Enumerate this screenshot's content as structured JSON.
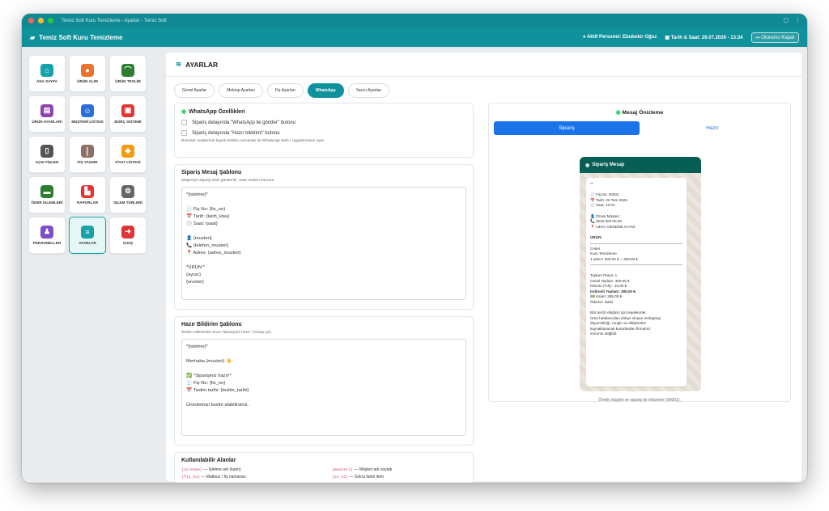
{
  "window": {
    "title": "Temiz Soft Kuru Temizleme - Ayarlar - Temiz Soft"
  },
  "colors": {
    "teal": "#10929c",
    "teal_dark": "#0f8a95",
    "whatsapp": "#075e54",
    "blue": "#1a73e8"
  },
  "appbar": {
    "app_name": "Temiz Soft Kuru Temizleme",
    "active_staff": "Aktif Personel: Ebubekir Oğuz",
    "datetime": "Tarih & Saat: 26.07.2026 - 13:34",
    "logout": "Oturumu Kapat"
  },
  "sidebar": {
    "tiles": [
      {
        "label": "ANA SAYFA",
        "icon": "home-icon",
        "color": "#16a2a8",
        "glyph": "⌂"
      },
      {
        "label": "ÜRÜN ALIM",
        "icon": "target-icon",
        "color": "#e8742d",
        "glyph": "●"
      },
      {
        "label": "ÜRÜN TESLİM",
        "icon": "hanger-icon",
        "color": "#2e7d32",
        "glyph": "⌒"
      },
      {
        "label": "ÜRÜN AYARLARI",
        "icon": "box-icon",
        "color": "#8e44ad",
        "glyph": "▤"
      },
      {
        "label": "MÜŞTERİ LİSTESİ",
        "icon": "users-icon",
        "color": "#2c6fd6",
        "glyph": "☺"
      },
      {
        "label": "BORÇ SİSTEMİ",
        "icon": "wallet-icon",
        "color": "#e03535",
        "glyph": "▣"
      },
      {
        "label": "AÇIK FİŞLER",
        "icon": "document-icon",
        "color": "#555555",
        "glyph": "▯"
      },
      {
        "label": "FİŞ YAZDIR",
        "icon": "barcode-icon",
        "color": "#8d6e63",
        "glyph": "║"
      },
      {
        "label": "FİYAT LİSTESİ",
        "icon": "tag-icon",
        "color": "#f39c12",
        "glyph": "◆"
      },
      {
        "label": "ÖDER İŞLEMLERİ",
        "icon": "cash-icon",
        "color": "#2e7d32",
        "glyph": "▬"
      },
      {
        "label": "RAPORLAR",
        "icon": "chart-icon",
        "color": "#e03535",
        "glyph": "▙"
      },
      {
        "label": "İŞLEM TÜRLERİ",
        "icon": "gears-icon",
        "color": "#666666",
        "glyph": "⚙"
      },
      {
        "label": "PERSONELLER",
        "icon": "person-icon",
        "color": "#7b4fc9",
        "glyph": "♟"
      },
      {
        "label": "AYARLAR",
        "icon": "sliders-icon",
        "color": "#16a2a8",
        "glyph": "≡"
      },
      {
        "label": "ÇIKIŞ",
        "icon": "logout-icon",
        "color": "#e03535",
        "glyph": "➜"
      }
    ]
  },
  "main": {
    "title": "AYARLAR",
    "tabs": [
      "Genel Ayarlar",
      "Mektup Ayarları",
      "Fiş Ayarları",
      "WhatsApp",
      "Yazıcı Ayarları"
    ]
  },
  "wa_features": {
    "title": "WhatsApp Özellikleri",
    "opt1": "Sipariş detayında \"WhatsApp ile gönder\" butonu",
    "opt2": "Sipariş detayında \"Hazır bildirimi\" butonu",
    "note": "Butonlar müşterinin kayıtlı telefon numarası ile WhatsApp Web / uygulamasını açar."
  },
  "order_template": {
    "title": "Sipariş Mesaj Şablonu",
    "note": "Müşteriye sipariş özeti gönderilir. Satır sonları korunur.",
    "body": "*{isletme}*\n\n🧾 Fiş No: {fis_no}\n📅 Tarih: {tarih_kisa}\n🕒 Saat: {saat}\n\n👤 {musteri}\n📞 {telefon_musteri}\n📍 Adres: {adres_musteri}\n\n*ÜRÜN:*\n{ayrac}\n{urunler}"
  },
  "ready_template": {
    "title": "Hazır Bildirim Şablonu",
    "note": "Teslim edilmeden önce \"siparişiniz hazır\" mesajı için.",
    "body": "*{isletme}*\n\nMerhaba {musteri} 👋\n\n✅ *Siparişiniz hazır!*\n🧾 Fiş No: {fis_no}\n📅 Teslim tarihi: {teslim_tarihi}\n\nÜrünlerinizi teslim alabilirsiniz.\n"
  },
  "fields": {
    "title": "Kullanılabilir Alanlar",
    "items": [
      {
        "code": "{isletme}",
        "desc": "— İşletme adı (kalın)"
      },
      {
        "code": "{musteri}",
        "desc": "— Müşteri adı soyadı"
      },
      {
        "code": "{fis_no}",
        "desc": "— Makbuz / fiş numarası"
      },
      {
        "code": "{sn_no}",
        "desc": "— Sıkıra farklı item"
      }
    ]
  },
  "preview": {
    "title": "Mesaj Önizleme",
    "tabs": [
      "Sipariş",
      "Hazır"
    ],
    "header": "Sipariş Mesajı",
    "footer": "Örnek müşteri ve sipariş ile önizleme (00001).",
    "lines": [
      "**",
      "",
      "🧾 Fiş No: 00001",
      "📅 Tarih: 26 Tem 2026",
      "🕒 Saat: 13:04",
      "",
      "👤 Örnek Müşteri",
      "📞 0532 000 00 00",
      "📍 Adres: DENEME KAYDI",
      "",
      "ÜRÜN:",
      "—",
      "Ceket",
      "Kuru Temizleme",
      "1 adet x 300,00 ₺ = 300,00 ₺",
      "—",
      "",
      "Toplam Parça: 1",
      "Genel Toplam: 300,00 ₺",
      "İskonto (%5): -15,00 ₺",
      "İndirimli Toplam: 285,00 ₺",
      "💵 Kalan: 285,00 ₺",
      "Ödeme: Nakit",
      "",
      "Bizi tercih ettiğiniz için teşekkürler.",
      "Ürün hatalarından dolayı oluşan renk/gergi",
      "dayanıklılığı, rengin ve dikişlerden",
      "kaynaklanacak kusurlardan firmamız",
      "sorumlu değildir."
    ]
  }
}
